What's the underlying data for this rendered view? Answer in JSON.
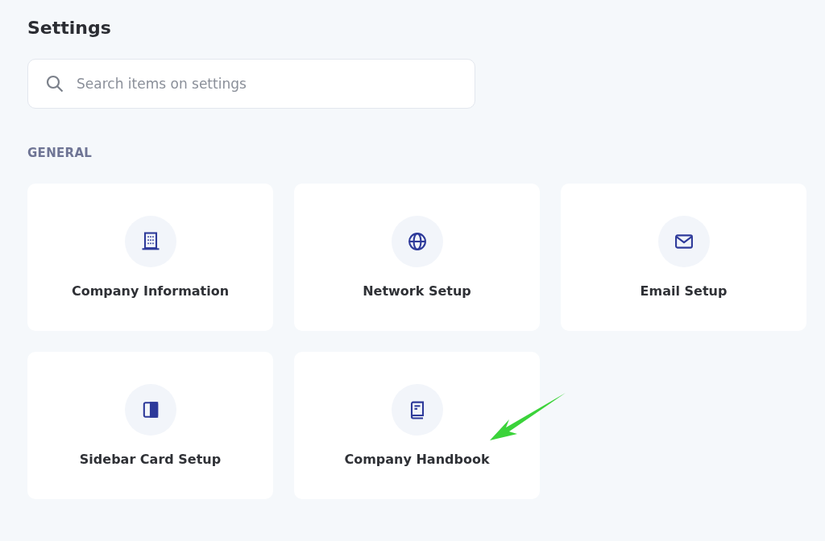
{
  "title": "Settings",
  "search": {
    "placeholder": "Search items on settings"
  },
  "section": "GENERAL",
  "items": [
    {
      "label": "Company Information",
      "kind": "building"
    },
    {
      "label": "Network Setup",
      "kind": "globe"
    },
    {
      "label": "Email Setup",
      "kind": "mail"
    },
    {
      "label": "Sidebar Card Setup",
      "kind": "panel"
    },
    {
      "label": "Company Handbook",
      "kind": "book"
    }
  ]
}
